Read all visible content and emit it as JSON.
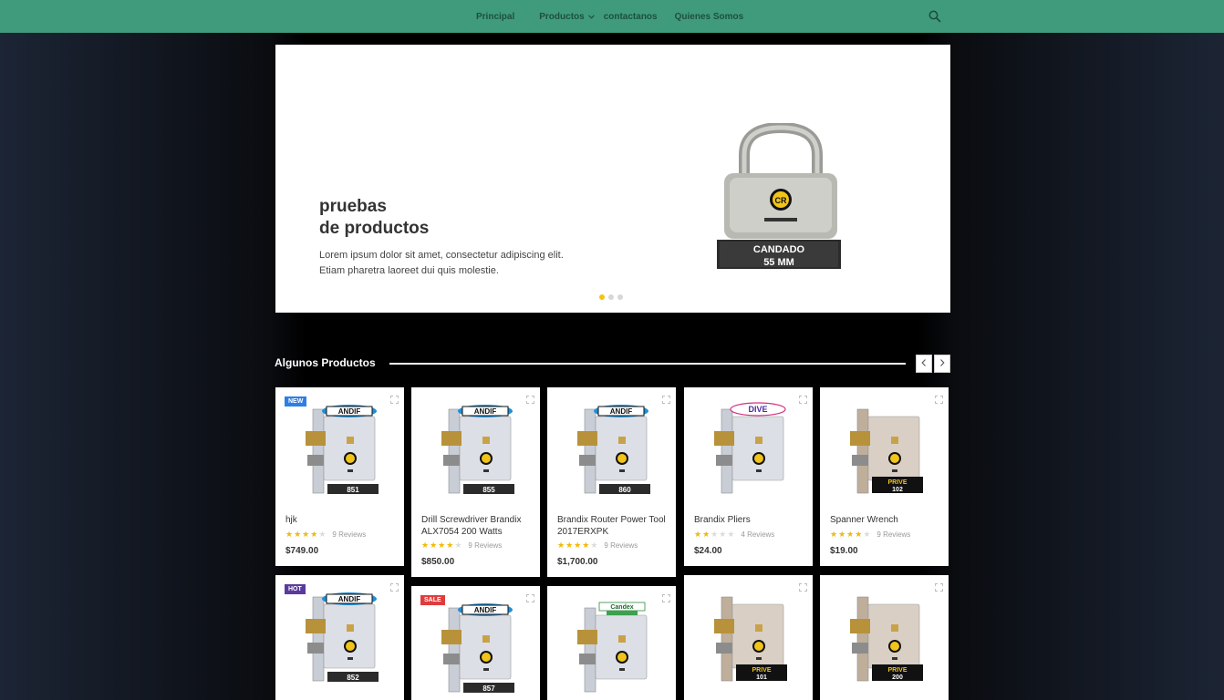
{
  "nav": {
    "items": [
      {
        "label": "Principal"
      },
      {
        "label": "Productos"
      },
      {
        "label": "contactanos"
      },
      {
        "label": "Quienes Somos"
      }
    ]
  },
  "hero": {
    "title_line1": "pruebas",
    "title_line2": "de productos",
    "text_line1": "Lorem ipsum dolor sit amet, consectetur adipiscing elit.",
    "text_line2": "Etiam pharetra laoreet dui quis molestie.",
    "image_label_line1": "CANDADO",
    "image_label_line2": "55 MM",
    "slides": 3,
    "active_slide": 1
  },
  "section": {
    "title": "Algunos Productos"
  },
  "colors": {
    "nav_bg": "#3f9b7c",
    "accent_dot": "#f3c312",
    "star": "#f0b90b",
    "badge_new": "#2f7ee3",
    "badge_hot": "#5b3a9d",
    "badge_sale": "#e03c3c"
  },
  "products": [
    {
      "name": "hjk",
      "rating": 4,
      "reviews": "9 Reviews",
      "price": "$749.00",
      "badge": "NEW",
      "code": "851",
      "brand": "ANDIF"
    },
    {
      "name": "Drill Screwdriver Brandix ALX7054 200 Watts",
      "rating": 4,
      "reviews": "9 Reviews",
      "price": "$850.00",
      "badge": "",
      "code": "855",
      "brand": "ANDIF"
    },
    {
      "name": "Brandix Router Power Tool 2017ERXPK",
      "rating": 4,
      "reviews": "9 Reviews",
      "price": "$1,700.00",
      "badge": "",
      "code": "860",
      "brand": "ANDIF"
    },
    {
      "name": "Brandix Pliers",
      "rating": 2,
      "reviews": "4 Reviews",
      "price": "$24.00",
      "badge": "",
      "code": "",
      "brand": "DIVE"
    },
    {
      "name": "Spanner Wrench",
      "rating": 4,
      "reviews": "9 Reviews",
      "price": "$19.00",
      "badge": "",
      "code": "102",
      "brand": "PRIVE"
    },
    {
      "name": "",
      "rating": 0,
      "reviews": "",
      "price": "",
      "badge": "HOT",
      "code": "852",
      "brand": "ANDIF"
    },
    {
      "name": "",
      "rating": 0,
      "reviews": "",
      "price": "",
      "badge": "SALE",
      "code": "857",
      "brand": "ANDIF"
    },
    {
      "name": "",
      "rating": 0,
      "reviews": "",
      "price": "",
      "badge": "",
      "code": "",
      "brand": "Candex"
    },
    {
      "name": "",
      "rating": 0,
      "reviews": "",
      "price": "",
      "badge": "",
      "code": "101",
      "brand": "PRIVE"
    },
    {
      "name": "",
      "rating": 0,
      "reviews": "",
      "price": "",
      "badge": "",
      "code": "200",
      "brand": "PRIVE"
    }
  ]
}
